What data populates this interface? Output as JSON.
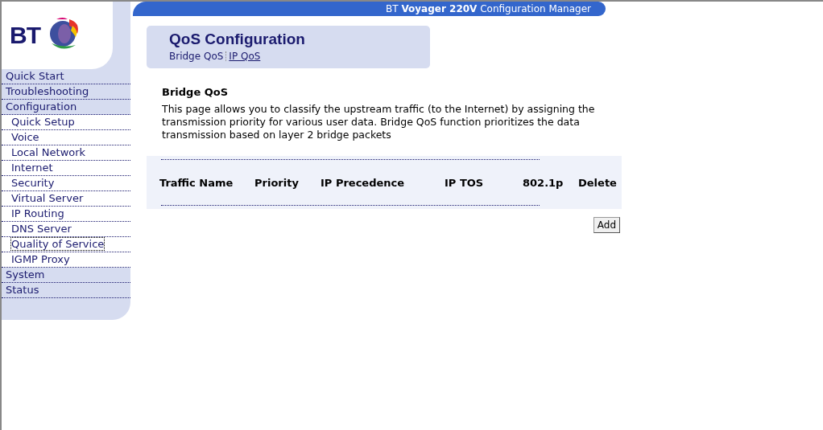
{
  "header": {
    "title": "BT **Voyager 220V** Configuration Manager"
  },
  "logo": {
    "text": "BT"
  },
  "sidebar": {
    "items": [
      {
        "label": "Quick Start",
        "kind": "section",
        "selected": false
      },
      {
        "label": "Troubleshooting",
        "kind": "section",
        "selected": false
      },
      {
        "label": "Configuration",
        "kind": "section",
        "selected": false
      },
      {
        "label": "Quick Setup",
        "kind": "sub",
        "selected": false
      },
      {
        "label": "Voice",
        "kind": "sub",
        "selected": false
      },
      {
        "label": "Local Network",
        "kind": "sub",
        "selected": false
      },
      {
        "label": "Internet",
        "kind": "sub",
        "selected": false
      },
      {
        "label": "Security",
        "kind": "sub",
        "selected": false
      },
      {
        "label": "Virtual Server",
        "kind": "sub",
        "selected": false
      },
      {
        "label": "IP Routing",
        "kind": "sub",
        "selected": false
      },
      {
        "label": "DNS Server",
        "kind": "sub",
        "selected": false
      },
      {
        "label": "Quality of Service",
        "kind": "sub",
        "selected": true
      },
      {
        "label": "IGMP Proxy",
        "kind": "sub",
        "selected": false
      },
      {
        "label": "System",
        "kind": "section",
        "selected": false
      },
      {
        "label": "Status",
        "kind": "section",
        "selected": false
      }
    ]
  },
  "page": {
    "title": "QoS Configuration",
    "tabs": [
      {
        "label": "Bridge QoS",
        "selected": true
      },
      {
        "label": "IP QoS",
        "selected": false
      }
    ]
  },
  "section": {
    "heading": "Bridge QoS",
    "description": "This page allows you to classify the upstream traffic (to the Internet) by assigning the transmission priority for various user data. Bridge QoS function prioritizes the data transmission based on layer 2 bridge packets"
  },
  "table": {
    "columns": [
      "Traffic Name",
      "Priority",
      "IP Precedence",
      "IP TOS",
      "802.1p",
      "Delete"
    ]
  },
  "buttons": [
    "Add"
  ]
}
